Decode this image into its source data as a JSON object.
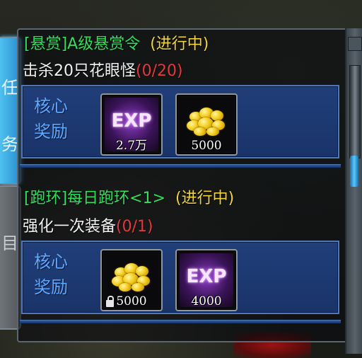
{
  "side_tabs": [
    {
      "glyph": "任",
      "glyph2": "务"
    },
    {
      "glyph": "目"
    }
  ],
  "quests": [
    {
      "title": "[悬赏]A级悬赏令",
      "status": "(进行中)",
      "description": "击杀20只花眼怪",
      "progress": "(0/20)",
      "reward_label": "核心奖励",
      "rewards": [
        {
          "icon": "exp-orb-icon",
          "count": "2.7万"
        },
        {
          "icon": "gold-coins-icon",
          "count": "5000"
        }
      ]
    },
    {
      "title": "[跑环]每日跑环<1>",
      "status": "(进行中)",
      "description": "强化一次装备",
      "progress": "(0/1)",
      "reward_label": "核心奖励",
      "rewards": [
        {
          "icon": "gold-coins-icon",
          "count": "5000",
          "bound": true
        },
        {
          "icon": "exp-orb-icon",
          "count": "4000"
        }
      ]
    }
  ],
  "colors": {
    "title_green": "#2fe05a",
    "status_yellow": "#f2d33a",
    "progress_red": "#e8383e",
    "reward_blue": "#5fa8ff",
    "panel_border": "#5b6670"
  }
}
